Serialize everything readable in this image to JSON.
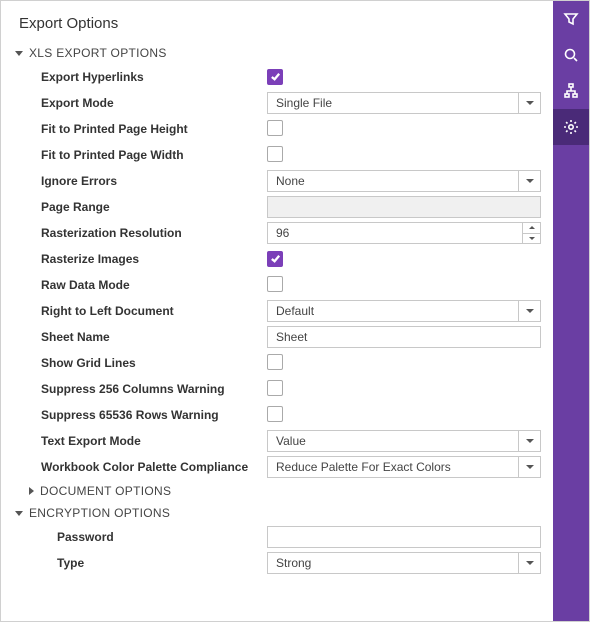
{
  "title": "Export Options",
  "sections": {
    "xls": {
      "label": "XLS EXPORT OPTIONS",
      "expanded": true
    },
    "doc": {
      "label": "DOCUMENT OPTIONS",
      "expanded": false
    },
    "enc": {
      "label": "ENCRYPTION OPTIONS",
      "expanded": true
    }
  },
  "xls": {
    "export_hyperlinks": {
      "label": "Export Hyperlinks",
      "checked": true
    },
    "export_mode": {
      "label": "Export Mode",
      "value": "Single File"
    },
    "fit_height": {
      "label": "Fit to Printed Page Height",
      "checked": false
    },
    "fit_width": {
      "label": "Fit to Printed Page Width",
      "checked": false
    },
    "ignore_errors": {
      "label": "Ignore Errors",
      "value": "None"
    },
    "page_range": {
      "label": "Page Range",
      "value": ""
    },
    "raster_res": {
      "label": "Rasterization Resolution",
      "value": "96"
    },
    "raster_img": {
      "label": "Rasterize Images",
      "checked": true
    },
    "raw_data": {
      "label": "Raw Data Mode",
      "checked": false
    },
    "rtl": {
      "label": "Right to Left Document",
      "value": "Default"
    },
    "sheet_name": {
      "label": "Sheet Name",
      "value": "Sheet"
    },
    "grid_lines": {
      "label": "Show Grid Lines",
      "checked": false
    },
    "sup256": {
      "label": "Suppress 256 Columns Warning",
      "checked": false
    },
    "sup65k": {
      "label": "Suppress 65536 Rows Warning",
      "checked": false
    },
    "text_mode": {
      "label": "Text Export Mode",
      "value": "Value"
    },
    "palette": {
      "label": "Workbook Color Palette Compliance",
      "value": "Reduce Palette For Exact Colors"
    }
  },
  "enc": {
    "password": {
      "label": "Password",
      "value": ""
    },
    "type": {
      "label": "Type",
      "value": "Strong"
    }
  },
  "sidebar": {
    "filter": "filter",
    "search": "search",
    "tree": "field-list",
    "settings": "settings"
  }
}
